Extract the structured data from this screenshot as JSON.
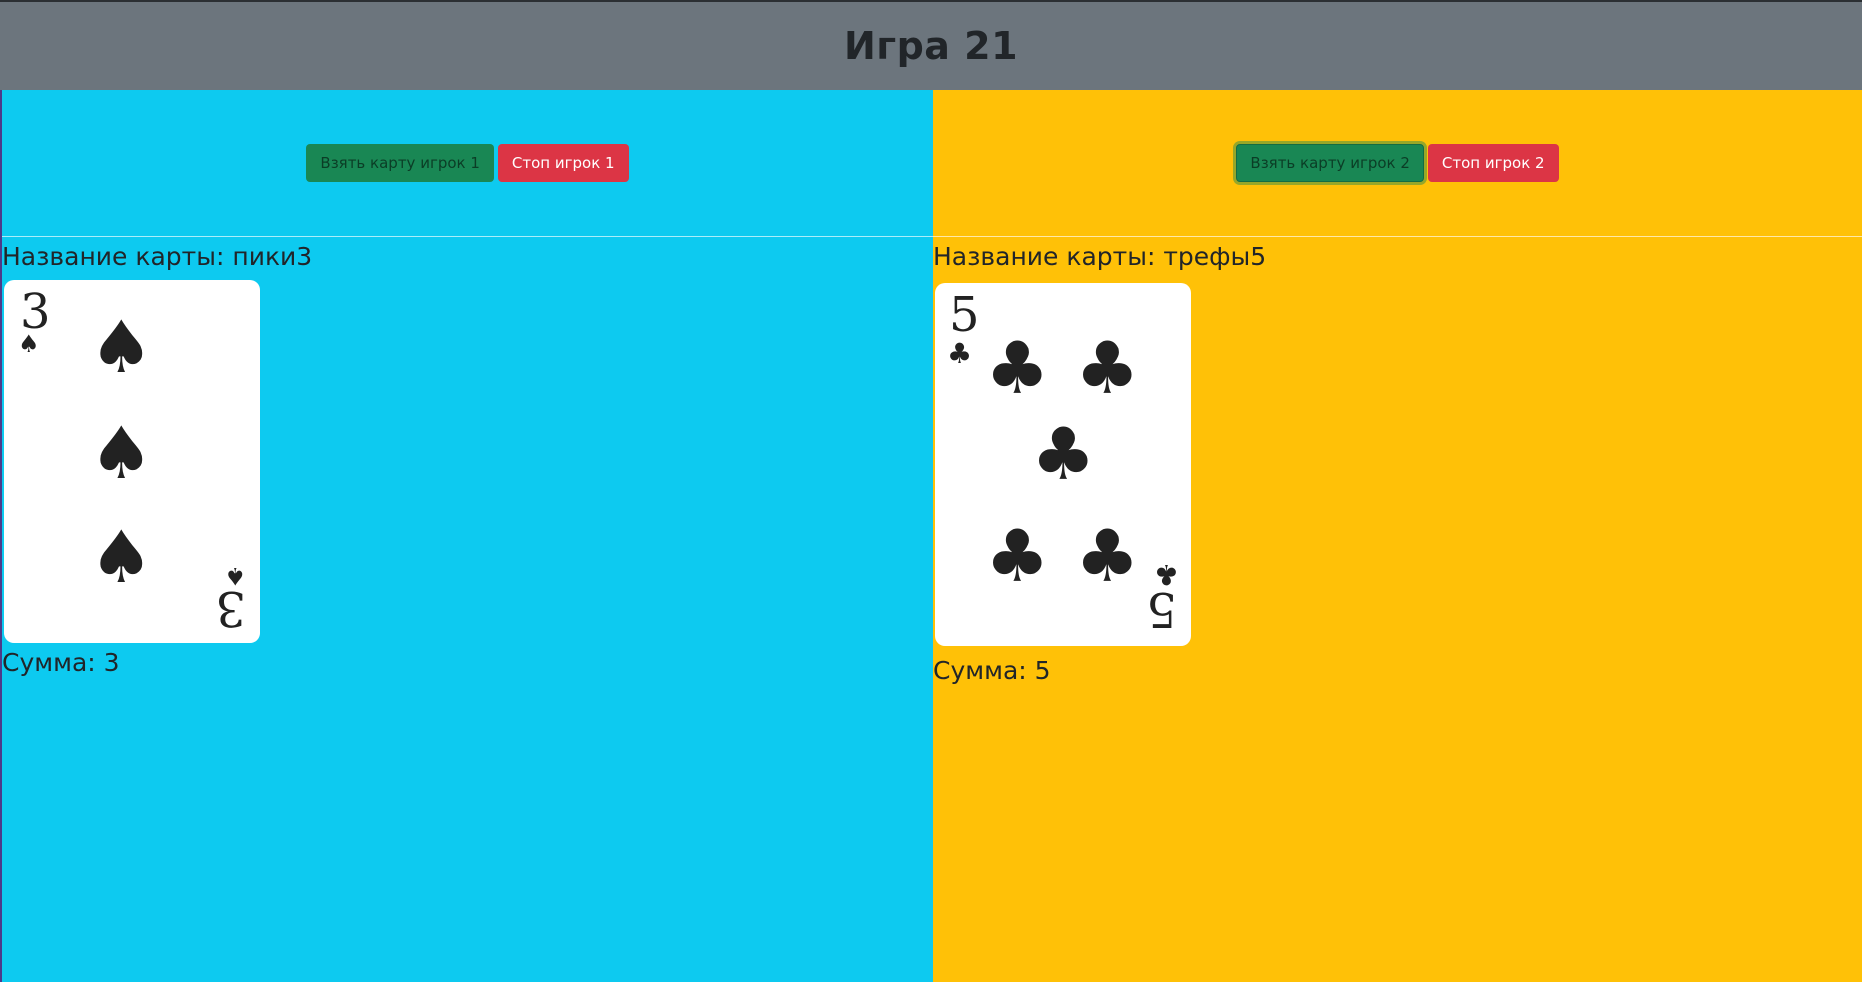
{
  "header": {
    "title": "Игра 21"
  },
  "players": [
    {
      "take_label": "Взять карту игрок 1",
      "stop_label": "Стоп игрок 1",
      "card_name": "Название карты: пики3",
      "card": {
        "rank": "3",
        "suit_symbol": "♠",
        "suit": "spades",
        "pip_count": 3
      },
      "sum": "Сумма: 3",
      "panel_color": "#0dcaf0"
    },
    {
      "take_label": "Взять карту игрок 2",
      "stop_label": "Стоп игрок 2",
      "card_name": "Название карты: трефы5",
      "card": {
        "rank": "5",
        "suit_symbol": "♣",
        "suit": "clubs",
        "pip_count": 5
      },
      "sum": "Сумма: 5",
      "panel_color": "#ffc107"
    }
  ],
  "colors": {
    "header_bg": "#6c757d",
    "take_button": "#198754",
    "stop_button": "#dc3545"
  }
}
